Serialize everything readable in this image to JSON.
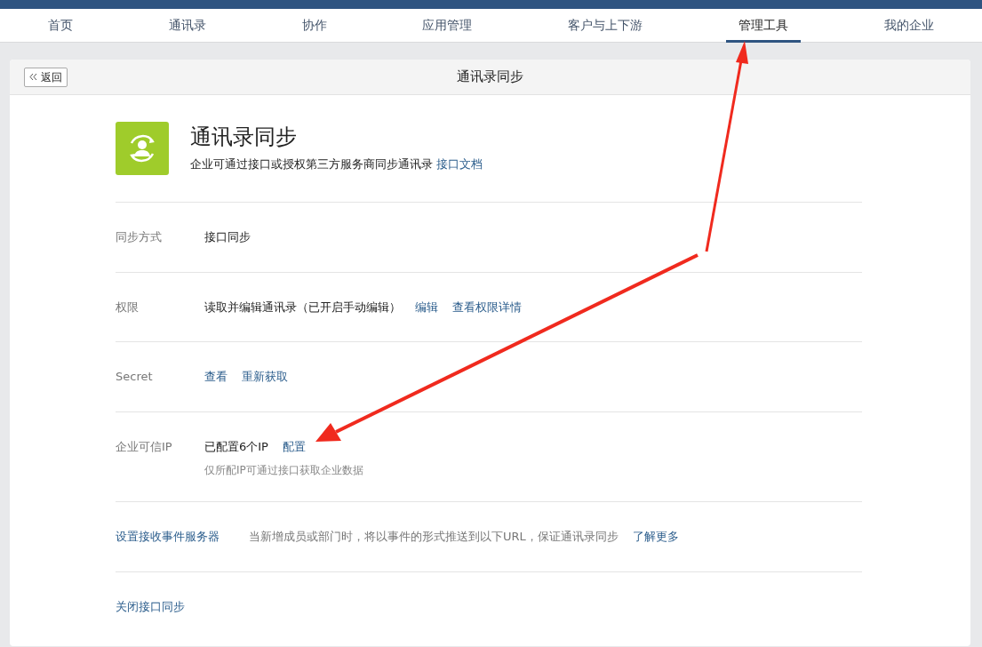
{
  "nav": {
    "tabs": [
      {
        "label": "首页",
        "selected": false
      },
      {
        "label": "通讯录",
        "selected": false
      },
      {
        "label": "协作",
        "selected": false
      },
      {
        "label": "应用管理",
        "selected": false
      },
      {
        "label": "客户与上下游",
        "selected": false
      },
      {
        "label": "管理工具",
        "selected": true
      },
      {
        "label": "我的企业",
        "selected": false
      }
    ]
  },
  "card": {
    "back_button": "返回",
    "title": "通讯录同步"
  },
  "intro": {
    "title": "通讯录同步",
    "description": "企业可通过接口或授权第三方服务商同步通讯录",
    "doc_link": "接口文档"
  },
  "settings": [
    {
      "label": "同步方式",
      "kind": "plain",
      "parts": [
        {
          "kind": "text",
          "text": "接口同步"
        }
      ]
    },
    {
      "label": "权限",
      "kind": "plain",
      "parts": [
        {
          "kind": "text",
          "text": "读取并编辑通讯录（已开启手动编辑）"
        },
        {
          "kind": "link",
          "text": "编辑"
        },
        {
          "kind": "link",
          "text": "查看权限详情"
        }
      ]
    },
    {
      "label": "Secret",
      "kind": "plain",
      "parts": [
        {
          "kind": "link",
          "text": "查看"
        },
        {
          "kind": "link",
          "text": "重新获取"
        }
      ]
    },
    {
      "label": "企业可信IP",
      "kind": "plain",
      "parts": [
        {
          "kind": "text",
          "text": "已配置6个IP"
        },
        {
          "kind": "link",
          "text": "配置"
        }
      ],
      "note": "仅所配IP可通过接口获取企业数据"
    },
    {
      "label": "设置接收事件服务器",
      "kind": "link",
      "parts": [
        {
          "kind": "muted",
          "text": "当新增成员或部门时，将以事件的形式推送到以下URL，保证通讯录同步"
        },
        {
          "kind": "link",
          "text": "了解更多"
        }
      ]
    },
    {
      "label": "关闭接口同步",
      "kind": "link"
    }
  ]
}
